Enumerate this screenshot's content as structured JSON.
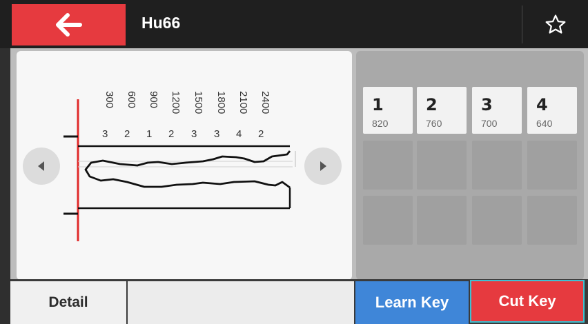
{
  "header": {
    "title": "Hu66",
    "back_icon": "arrow-left-icon",
    "favorite_icon": "star-outline-icon"
  },
  "key_diagram": {
    "spacings": [
      "300",
      "600",
      "900",
      "1200",
      "1500",
      "1800",
      "2100",
      "2400"
    ],
    "depths": [
      "3",
      "2",
      "1",
      "2",
      "3",
      "3",
      "4",
      "2"
    ]
  },
  "cuts": [
    {
      "number": "1",
      "depth": "820"
    },
    {
      "number": "2",
      "depth": "760"
    },
    {
      "number": "3",
      "depth": "700"
    },
    {
      "number": "4",
      "depth": "640"
    }
  ],
  "buttons": {
    "detail": "Detail",
    "learn_key": "Learn Key",
    "cut_key": "Cut Key"
  },
  "colors": {
    "accent_red": "#e63a3f",
    "accent_blue": "#3f86d8",
    "focus_outline": "#3ec0d1"
  }
}
